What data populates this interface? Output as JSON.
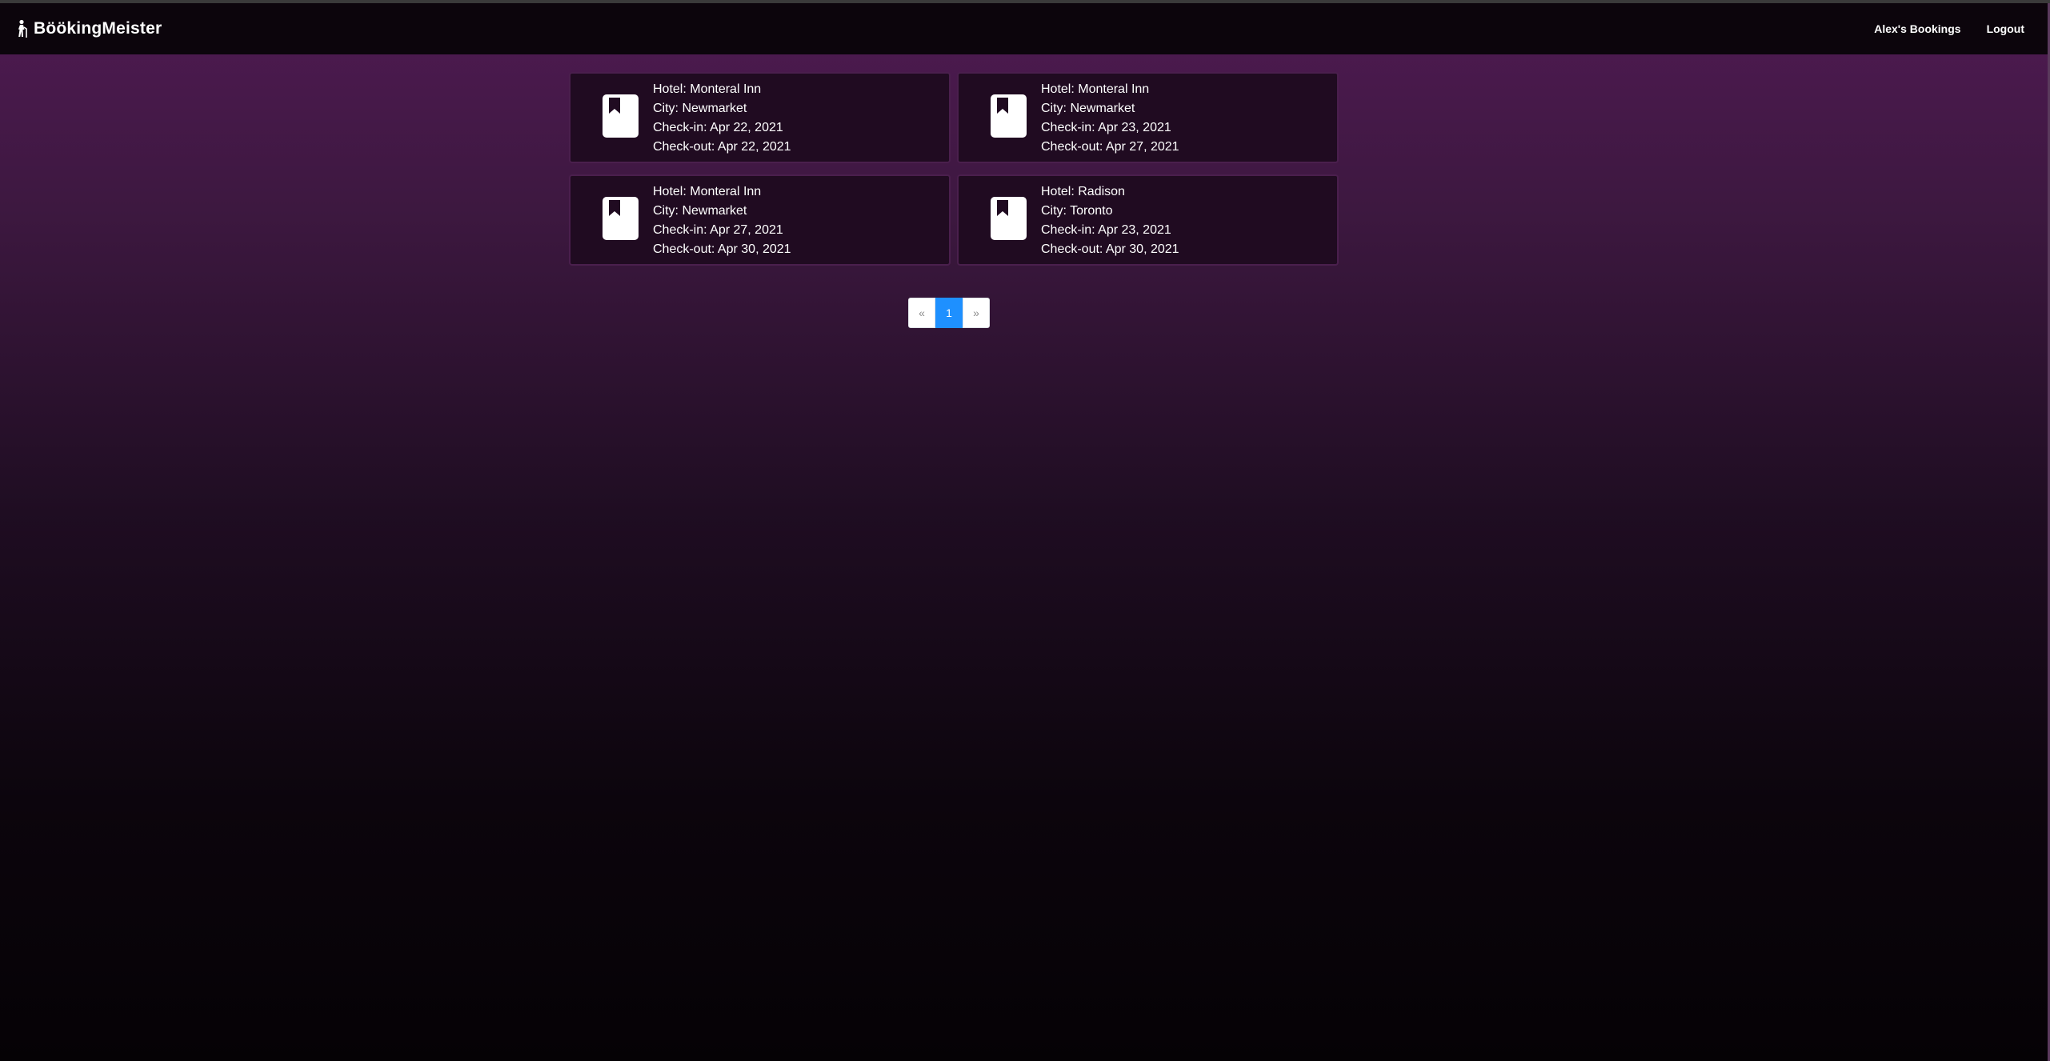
{
  "navbar": {
    "brand": "BöökingMeister",
    "links": [
      "Alex's Bookings",
      "Logout"
    ]
  },
  "bookings": [
    {
      "hotel": "Hotel: Monteral Inn",
      "city": "City: Newmarket",
      "check_in": "Check-in: Apr 22, 2021",
      "check_out": "Check-out: Apr 22, 2021"
    },
    {
      "hotel": "Hotel: Monteral Inn",
      "city": "City: Newmarket",
      "check_in": "Check-in: Apr 23, 2021",
      "check_out": "Check-out: Apr 27, 2021"
    },
    {
      "hotel": "Hotel: Monteral Inn",
      "city": "City: Newmarket",
      "check_in": "Check-in: Apr 27, 2021",
      "check_out": "Check-out: Apr 30, 2021"
    },
    {
      "hotel": "Hotel: Radison",
      "city": "City: Toronto",
      "check_in": "Check-in: Apr 23, 2021",
      "check_out": "Check-out: Apr 30, 2021"
    }
  ],
  "pagination": {
    "prev": "«",
    "current": "1",
    "next": "»"
  },
  "colors": {
    "accent": "#1e90ff",
    "card_bg": "#200b21",
    "navbar_bg": "#0c050c"
  },
  "icons": {
    "brand": "person-with-cane-icon",
    "booking": "bookmark-book-icon"
  }
}
